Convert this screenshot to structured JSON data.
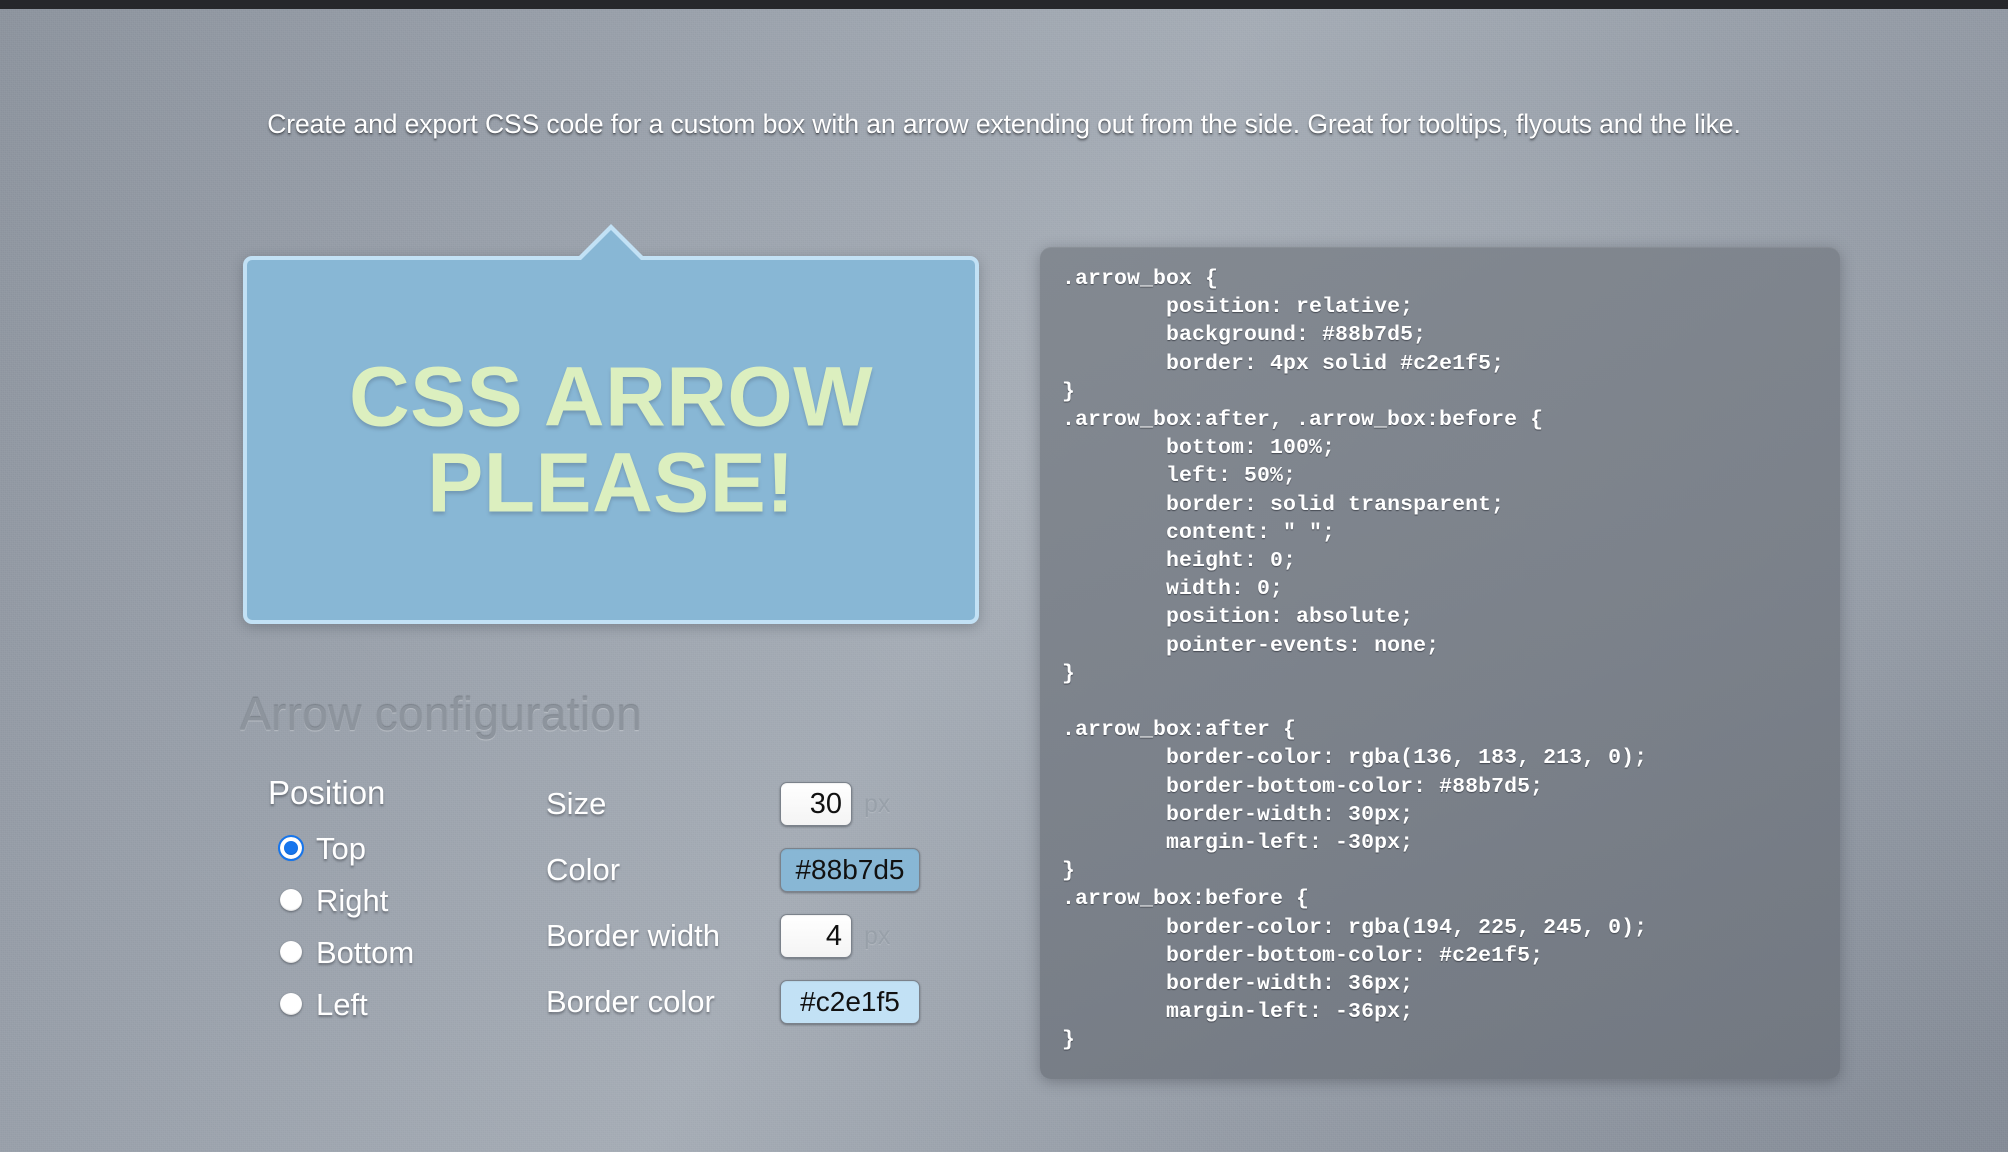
{
  "page": {
    "tagline": "Create and export CSS code for a custom box with an arrow extending out from the side. Great for tooltips, flyouts and the like."
  },
  "preview": {
    "box_text": "CSS ARROW PLEASE!",
    "fill_color": "#88b7d5",
    "border_color": "#c2e1f5",
    "arrow_position": "Top",
    "arrow_size_px": 30,
    "border_width_px": 4
  },
  "config": {
    "heading": "Arrow configuration",
    "position": {
      "legend": "Position",
      "selected": "Top",
      "options": [
        {
          "label": "Top",
          "checked": true
        },
        {
          "label": "Right",
          "checked": false
        },
        {
          "label": "Bottom",
          "checked": false
        },
        {
          "label": "Left",
          "checked": false
        }
      ]
    },
    "fields": [
      {
        "label": "Size",
        "value": "30",
        "unit": "px",
        "kind": "number"
      },
      {
        "label": "Color",
        "value": "#88b7d5",
        "unit": "",
        "kind": "color",
        "swatch": "#88b7d5"
      },
      {
        "label": "Border width",
        "value": "4",
        "unit": "px",
        "kind": "number"
      },
      {
        "label": "Border color",
        "value": "#c2e1f5",
        "unit": "",
        "kind": "color",
        "swatch": "#c2e1f5"
      }
    ]
  },
  "code": {
    "text": ".arrow_box {\n\tposition: relative;\n\tbackground: #88b7d5;\n\tborder: 4px solid #c2e1f5;\n}\n.arrow_box:after, .arrow_box:before {\n\tbottom: 100%;\n\tleft: 50%;\n\tborder: solid transparent;\n\tcontent: \" \";\n\theight: 0;\n\twidth: 0;\n\tposition: absolute;\n\tpointer-events: none;\n}\n\n.arrow_box:after {\n\tborder-color: rgba(136, 183, 213, 0);\n\tborder-bottom-color: #88b7d5;\n\tborder-width: 30px;\n\tmargin-left: -30px;\n}\n.arrow_box:before {\n\tborder-color: rgba(194, 225, 245, 0);\n\tborder-bottom-color: #c2e1f5;\n\tborder-width: 36px;\n\tmargin-left: -36px;\n}"
  }
}
